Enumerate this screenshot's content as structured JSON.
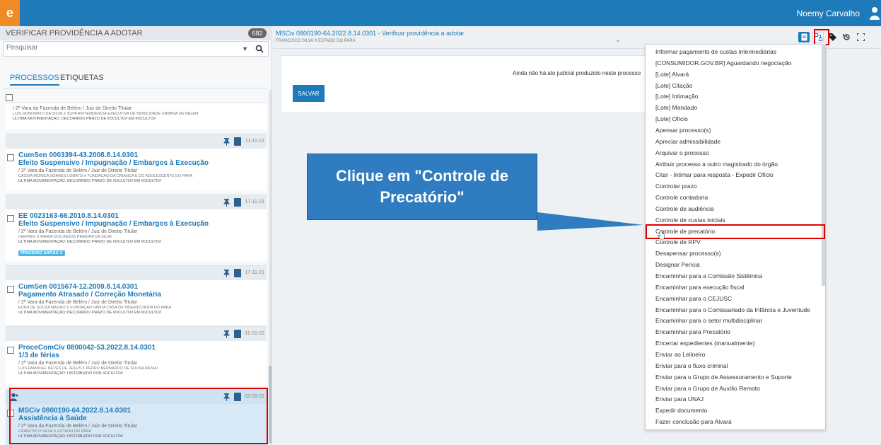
{
  "app": {
    "logo": "e",
    "user_name": "Noemy Carvalho"
  },
  "task_list": {
    "title": "VERIFICAR PROVIDÊNCIA A ADOTAR",
    "count": "682",
    "search_placeholder": "Pesquisar",
    "tabs": [
      "PROCESSOS",
      "ETIQUETAS"
    ]
  },
  "cards": [
    {
      "date": "",
      "number": "",
      "classe": "",
      "vara": "/ 2ª Vara da Fazenda de Belém / Juiz de Direito Titular",
      "parts": "LUIS HONORATO DA SILVA X SUPERINTENDENCIA EXECUTIVA DE MOBILIDADE URBANA DE BELEM",
      "mov": "ÚLTIMA MOVIMENTAÇÃO: DECORRIDO PRAZO DE #OCULTO# EM #OCULTO#"
    },
    {
      "date": "11-11-21",
      "number": "CumSen 0003394-43.2008.8.14.0301",
      "classe": "Efeito Suspensivo / Impugnação / Embargos à Execução",
      "vara": "/ 2ª Vara da Fazenda de Belém / Juiz de Direito Titular",
      "parts": "CASSIA MONICA SOARES LOBATO X FUNDACAO DA CRIANCA E DO ADOLESCENTE DO PARA",
      "mov": "ÚLTIMA MOVIMENTAÇÃO: DECORRIDO PRAZO DE #OCULTO# EM #OCULTO#"
    },
    {
      "date": "17-11-21",
      "number": "EE 0023163-66.2010.8.14.0301",
      "classe": "Efeito Suspensivo / Impugnação / Embargos à Execução",
      "vara": "/ 2ª Vara da Fazenda de Belém / Juiz de Direito Titular",
      "parts": "IGEPREV X MARIA DOS ANJOS PEREIRA DA SILVA",
      "mov": "ÚLTIMA MOVIMENTAÇÃO: DECORRIDO PRAZO DE #OCULTO# EM #OCULTO#",
      "badge": "PROCESSO ANTIGO ✕"
    },
    {
      "date": "17-11-21",
      "number": "CumSen 0015674-12.2009.8.14.0301",
      "classe": "Pagamento Atrasado / Correção Monetária",
      "vara": "/ 2ª Vara da Fazenda de Belém / Juiz de Direito Titular",
      "parts": "EDNA DE SOUZA MAGNO X FUNDAÇÃO SANTA CASA DE MISERICÓRDIA DO PARÁ",
      "mov": "ÚLTIMA MOVIMENTAÇÃO: DECORRIDO PRAZO DE #OCULTO# EM #OCULTO#"
    },
    {
      "date": "31-01-22",
      "number": "ProceComCiv 0800042-53.2022.8.14.0301",
      "classe": "1/3 de férias",
      "vara": "/ 2ª Vara da Fazenda de Belém / Juiz de Direito Titular",
      "parts": "LUIS EMANUEL NEVES DE JESUS X PEDRO BERNARDO DE SOUSA PAVÃO",
      "mov": "ÚLTIMA MOVIMENTAÇÃO: DISTRIBUÍDO POR #OCULTO#"
    },
    {
      "date": "02-05-22",
      "number": "MSCiv 0800190-64.2022.8.14.0301",
      "classe": "Assistência à Saúde",
      "vara": "/ 2ª Vara da Fazenda de Belém / Juiz de Direito Titular",
      "parts": "FRANCISCO SILVA X ESTADO DO PARÁ",
      "mov": "ÚLTIMA MOVIMENTAÇÃO: DISTRIBUÍDO POR #OCULTO#"
    }
  ],
  "main": {
    "title": "MSCiv 0800190-64.2022.8.14.0301 - Verificar providência a adotar",
    "subtitle": "FRANCISCO SILVA X ESTADO DO PARÁ",
    "message": "Ainda não há ato judicial produzido neste processo",
    "save_label": "SALVAR"
  },
  "callout": {
    "line1": "Clique em \"Controle de",
    "line2": "Precatório\""
  },
  "menu": {
    "items": [
      "Informar pagamento de custas intermediárias",
      "[CONSUMIDOR.GOV.BR] Aguardando negociação",
      "[Lote] Alvará",
      "[Lote] Citação",
      "[Lote] Intimação",
      "[Lote] Mandado",
      "[Lote] Ofício",
      "Apensar processo(s)",
      "Apreciar admissibilidade",
      "Arquivar o processo",
      "Atribuir processo a outro magistrado do órgão",
      "Citar - Intimar para resposta - Expedir Ofício",
      "Controlar prazo",
      "Controle contadoria",
      "Controle de audiência",
      "Controle de custas iniciais",
      "Controle de precatório",
      "Controle de RPV",
      "Desapensar processo(s)",
      "Designar Perícia",
      "Encaminhar para a Comissão Sistêmica",
      "Encaminhar para execução fiscal",
      "Encaminhar para o CEJUSC",
      "Encaminhar para o Comissariado da Infância e Juventude",
      "Encaminhar para o setor multidisciplinar",
      "Encaminhar para Precatório",
      "Encerrar expedientes (manualmente)",
      "Enviar ao Leiloeiro",
      "Enviar para o fluxo criminal",
      "Enviar para o Grupo de Assessoramento e Suporte",
      "Enviar para o Grupo de Auxílio Remoto",
      "Enviar para UNAJ",
      "Expedir documento",
      "Fazer conclusão para Alvará"
    ]
  },
  "colors": {
    "brand": "#1e7ab8",
    "logo": "#f08a24",
    "highlight": "#e00000",
    "callout": "#2f7cc0"
  }
}
